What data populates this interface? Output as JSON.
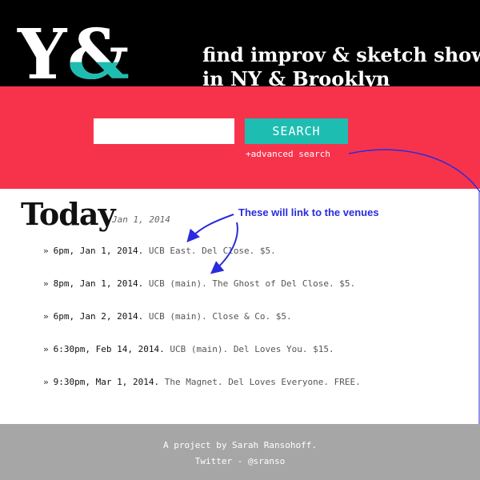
{
  "colors": {
    "header_bg": "#000000",
    "accent_red": "#f7334c",
    "accent_teal": "#1ebdb2",
    "annotation_blue": "#2b2bdc",
    "footer_bg": "#a6a6a6"
  },
  "header": {
    "logo": {
      "letter": "Y",
      "ampersand": "&"
    },
    "tagline_line1": "find improv & sketch shows",
    "tagline_line2": "in NY & Brooklyn"
  },
  "search": {
    "input_value": "",
    "input_placeholder": "",
    "button_label": "SEARCH",
    "advanced_link": "+advanced search"
  },
  "today": {
    "title": "Today",
    "date": "Jan 1, 2014"
  },
  "annotation": {
    "text": "These will link to the venues"
  },
  "shows": [
    {
      "when": "6pm, Jan 1, 2014.",
      "venue": "UCB East.",
      "rest": "Del Close. $5."
    },
    {
      "when": "8pm, Jan 1, 2014.",
      "venue": "UCB (main).",
      "rest": "The Ghost of Del Close. $5."
    },
    {
      "when": "6pm, Jan 2, 2014.",
      "venue": "UCB (main).",
      "rest": "Close & Co. $5."
    },
    {
      "when": "6:30pm, Feb 14, 2014.",
      "venue": "UCB (main).",
      "rest": "Del Loves You. $15."
    },
    {
      "when": "9:30pm, Mar 1, 2014.",
      "venue": "The Magnet.",
      "rest": "Del Loves Everyone. FREE."
    }
  ],
  "list_bullet": "»",
  "footer": {
    "credit": "A project by Sarah Ransohoff.",
    "twitter_prefix": "Twitter - ",
    "twitter_handle": "@sranso"
  }
}
